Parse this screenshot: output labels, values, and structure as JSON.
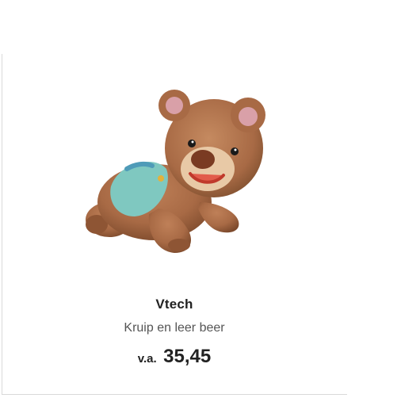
{
  "product": {
    "brand": "Vtech",
    "name": "Kruip en leer beer",
    "price_prefix": "v.a.",
    "price": "35,45",
    "image_alt": "teddy-bear-crawling-toy"
  },
  "colors": {
    "fur": "#a86a45",
    "fur_dark": "#7d4a2c",
    "diaper": "#7fc8c0",
    "muzzle": "#e8c9a6",
    "ear_inner": "#d9a0a8",
    "text_dark": "#222222",
    "text_muted": "#555555",
    "border": "#d9d9d9"
  }
}
